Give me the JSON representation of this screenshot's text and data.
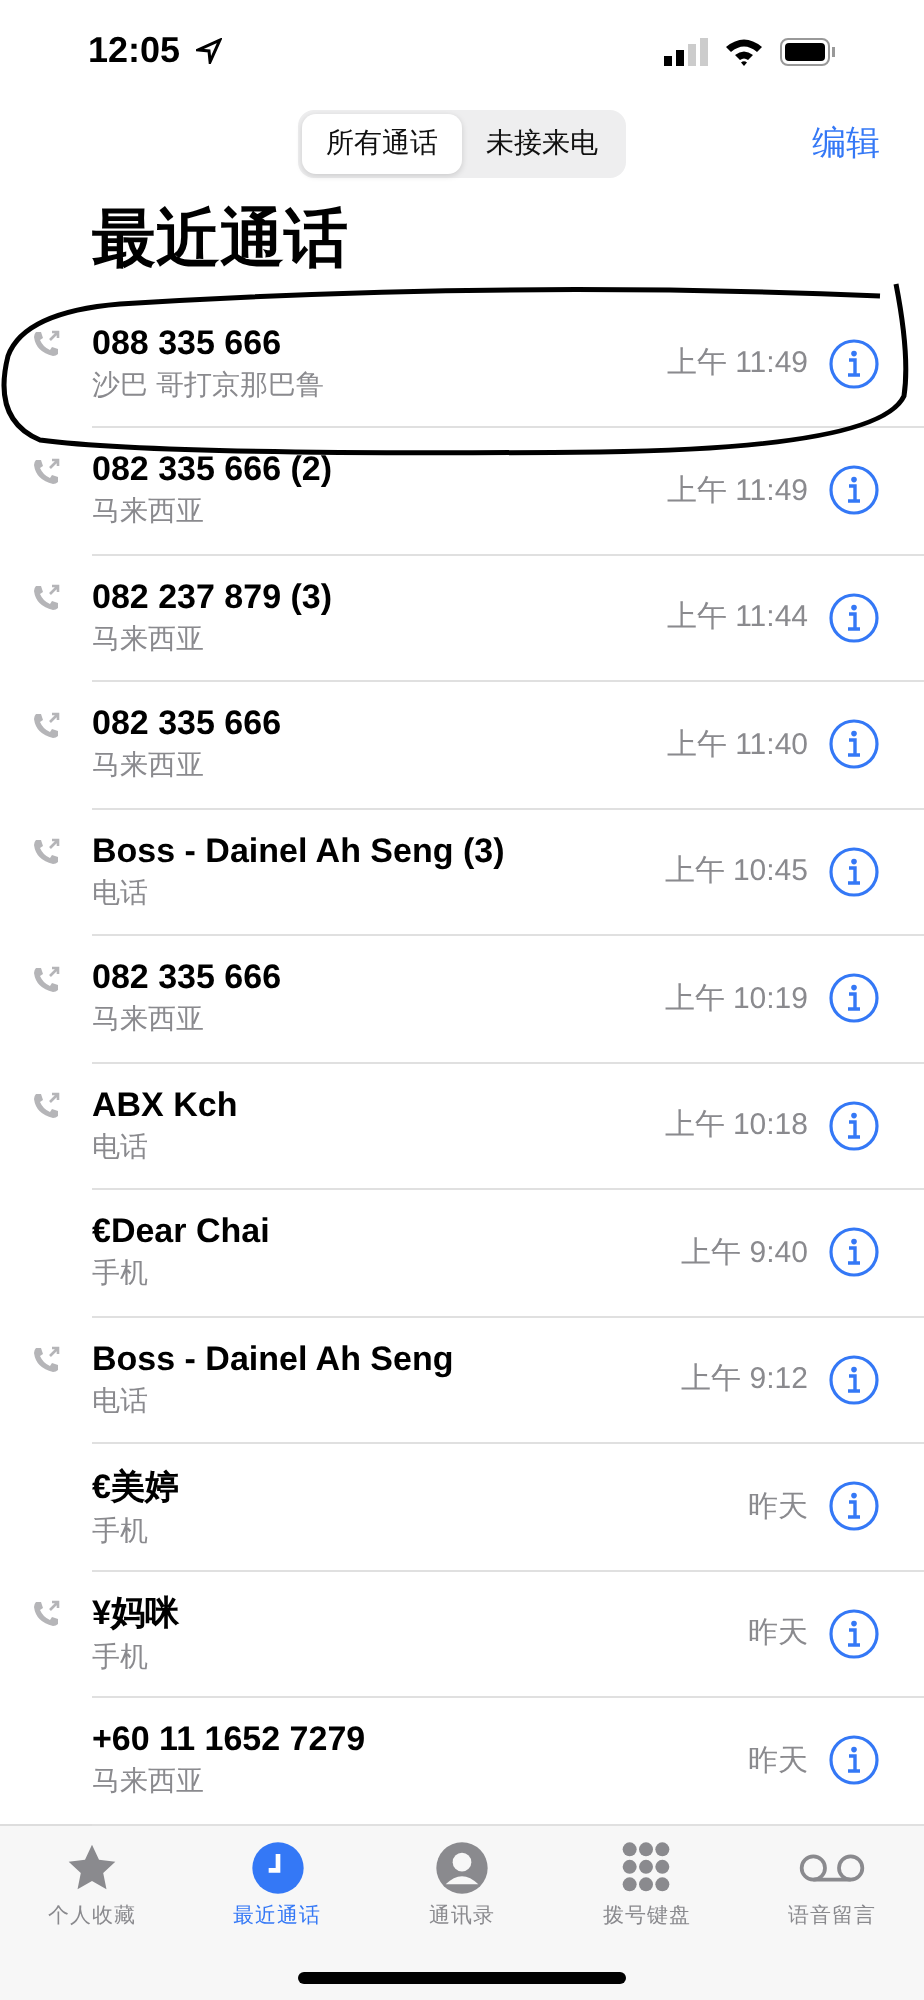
{
  "status_bar": {
    "time": "12:05"
  },
  "segments": [
    {
      "label": "所有通话",
      "selected": true
    },
    {
      "label": "未接来电",
      "selected": false
    }
  ],
  "edit_label": "编辑",
  "title": "最近通话",
  "calls": [
    {
      "name": "088 335 666",
      "detail": "沙巴 哥打京那巴鲁",
      "time": "上午 11:49",
      "outgoing": true,
      "marked": true
    },
    {
      "name": "082 335 666 (2)",
      "detail": "马来西亚",
      "time": "上午 11:49",
      "outgoing": true,
      "marked": false
    },
    {
      "name": "082 237 879 (3)",
      "detail": "马来西亚",
      "time": "上午 11:44",
      "outgoing": true,
      "marked": false
    },
    {
      "name": "082 335 666",
      "detail": "马来西亚",
      "time": "上午 11:40",
      "outgoing": true,
      "marked": false
    },
    {
      "name": "Boss - Dainel Ah Seng (3)",
      "detail": "电话",
      "time": "上午 10:45",
      "outgoing": true,
      "marked": false
    },
    {
      "name": "082 335 666",
      "detail": "马来西亚",
      "time": "上午 10:19",
      "outgoing": true,
      "marked": false
    },
    {
      "name": "ABX Kch",
      "detail": "电话",
      "time": "上午 10:18",
      "outgoing": true,
      "marked": false
    },
    {
      "name": "€Dear Chai",
      "detail": "手机",
      "time": "上午 9:40",
      "outgoing": false,
      "marked": false
    },
    {
      "name": "Boss - Dainel Ah Seng",
      "detail": "电话",
      "time": "上午 9:12",
      "outgoing": true,
      "marked": false
    },
    {
      "name": "€美婷",
      "detail": "手机",
      "time": "昨天",
      "outgoing": false,
      "marked": false
    },
    {
      "name": "¥妈咪",
      "detail": "手机",
      "time": "昨天",
      "outgoing": true,
      "marked": false
    },
    {
      "name": "+60 11 1652 7279",
      "detail": "马来西亚",
      "time": "昨天",
      "outgoing": false,
      "marked": false
    }
  ],
  "tabs": [
    {
      "kind": "star",
      "label": "个人收藏",
      "selected": false
    },
    {
      "kind": "clock",
      "label": "最近通话",
      "selected": true
    },
    {
      "kind": "person",
      "label": "通讯录",
      "selected": false
    },
    {
      "kind": "keypad",
      "label": "拨号键盘",
      "selected": false
    },
    {
      "kind": "voicemail",
      "label": "语音留言",
      "selected": false
    }
  ]
}
